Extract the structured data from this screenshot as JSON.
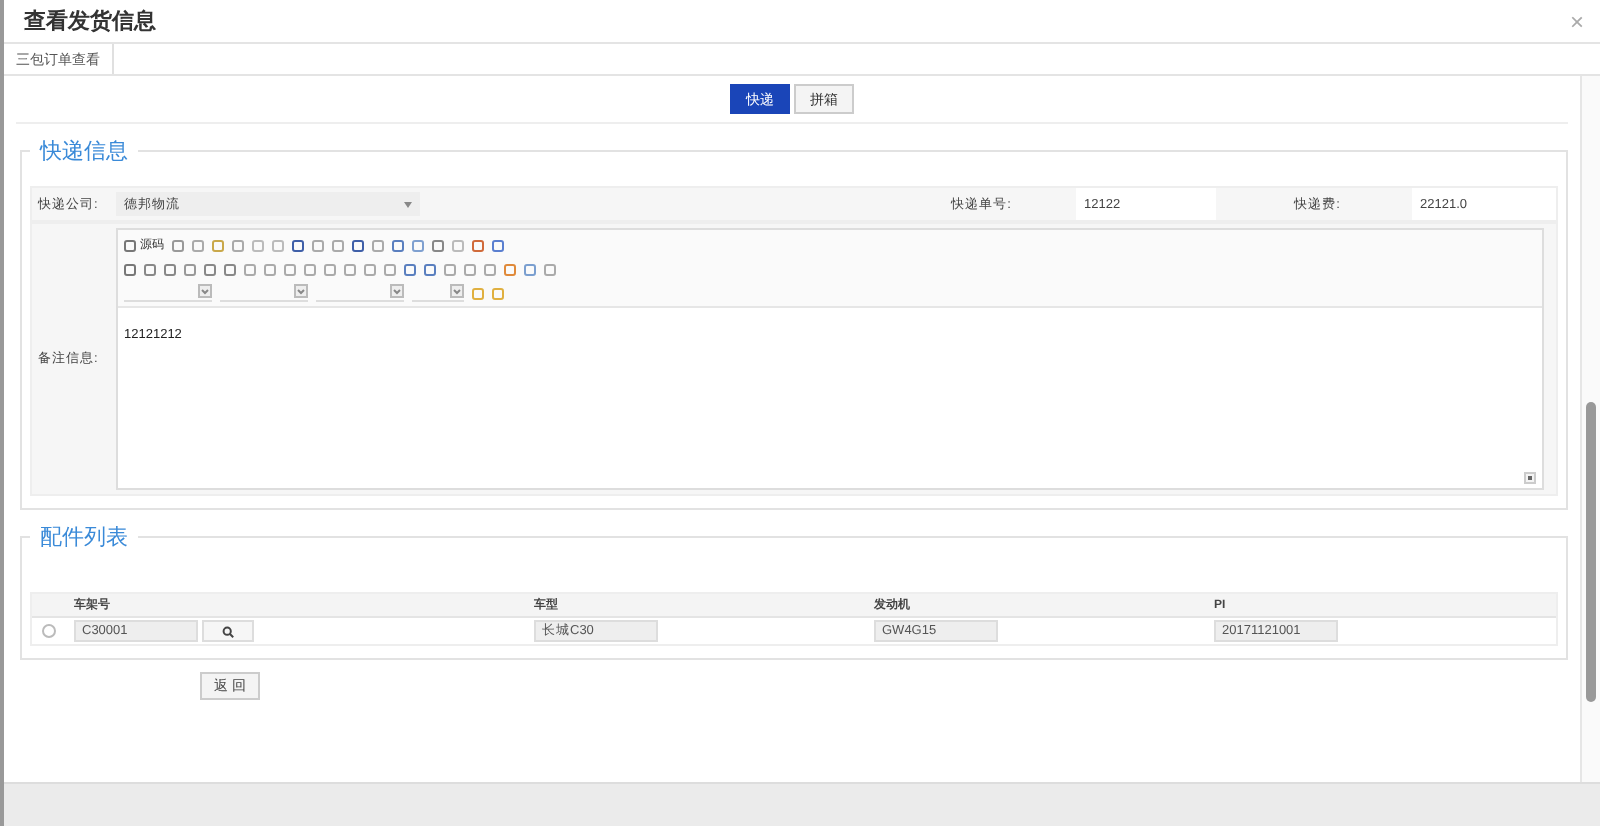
{
  "window": {
    "title": "查看发货信息",
    "close": "×"
  },
  "tabs": [
    {
      "label": "三包订单查看",
      "selected": true
    }
  ],
  "mode_buttons": [
    {
      "label": "快递",
      "selected": true
    },
    {
      "label": "拼箱",
      "selected": false
    }
  ],
  "express_section": {
    "legend": "快递信息",
    "fields": [
      {
        "label": "快递公司:",
        "value": "德邦物流",
        "kind": "select"
      },
      {
        "label": "快递单号:",
        "value": "12122",
        "kind": "text"
      },
      {
        "label": "快递费:",
        "value": "22121.0",
        "kind": "text"
      }
    ],
    "remark": {
      "label": "备注信息:",
      "toolbar_source": "源码",
      "content": "12121212"
    }
  },
  "parts_section": {
    "legend": "配件列表",
    "table": {
      "columns": [
        "车架号",
        "车型",
        "发动机",
        "PI"
      ],
      "rows": [
        {
          "selected": false,
          "cells": [
            "C30001",
            "长城C30",
            "GW4G15",
            "20171121001"
          ]
        }
      ]
    }
  },
  "footer": {
    "back_button": "返 回"
  }
}
